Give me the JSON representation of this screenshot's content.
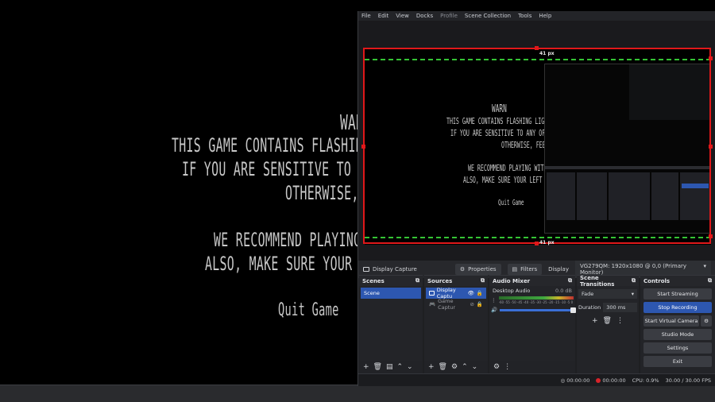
{
  "game": {
    "warning_title": "WARN",
    "lines": [
      "THIS GAME CONTAINS FLASHING LIGHTS, LOUD N",
      "IF YOU ARE SENSITIVE TO ANY OF THESE, PLE",
      "OTHERWISE, FEEL",
      "WE RECOMMEND PLAYING WITH HEAD",
      "ALSO, MAKE SURE YOUR LEFT AND RIG"
    ],
    "quit_label": "Quit Game"
  },
  "obs": {
    "menu": [
      "File",
      "Edit",
      "View",
      "Docks",
      "Profile",
      "Scene Collection",
      "Tools",
      "Help"
    ],
    "preview": {
      "top_px_label": "41 px",
      "bottom_px_label": "41 px",
      "canvas_lines": [
        "WARN",
        "THIS GAME CONTAINS FLASHING LIGHTS, LOUD N",
        "IF YOU ARE SENSITIVE TO ANY OF THESE, PLE",
        "OTHERWISE, FEEL",
        "WE RECOMMEND PLAYING WITH HEA",
        "ALSO, MAKE SURE YOUR LEFT AND",
        "Quit Game"
      ]
    },
    "source_toolbar": {
      "source_name": "Display Capture",
      "properties_label": "Properties",
      "filters_label": "Filters",
      "display_label": "Display",
      "display_value": "VG279QM: 1920x1080 @ 0,0 (Primary Monitor)"
    },
    "scenes": {
      "title": "Scenes",
      "items": [
        "Scene"
      ]
    },
    "sources": {
      "title": "Sources",
      "items": [
        "Display Captu",
        "Game Captur"
      ]
    },
    "audio_mixer": {
      "title": "Audio Mixer",
      "track_name": "Desktop Audio",
      "track_level": "0.0 dB",
      "scale": "-60 -55 -50 -45 -40 -35 -30 -25 -20 -15 -10 -5 0"
    },
    "transitions": {
      "title": "Scene Transitions",
      "type": "Fade",
      "duration_label": "Duration",
      "duration_value": "300 ms"
    },
    "controls": {
      "title": "Controls",
      "start_streaming": "Start Streaming",
      "stop_recording": "Stop Recording",
      "start_virtual_camera": "Start Virtual Camera",
      "studio_mode": "Studio Mode",
      "settings": "Settings",
      "exit": "Exit"
    },
    "status": {
      "stream_time": "00:00:00",
      "rec_time": "00:00:00",
      "cpu": "CPU: 0.9%",
      "fps": "30.00 / 30.00 FPS"
    },
    "colors": {
      "accent": "#2d57b0",
      "crop_red": "#e0181a",
      "guide_green": "#35c435"
    }
  }
}
